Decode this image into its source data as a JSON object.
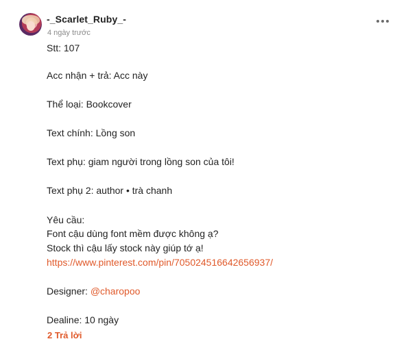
{
  "comment": {
    "author": "-_Scarlet_Ruby_-",
    "time": "4 ngày trước",
    "menu_icon": "more-dots-icon",
    "accent_color": "#e0592a",
    "lines": {
      "stt": "Stt: 107",
      "acc": "Acc nhận + trả: Acc này",
      "category": "Thể loại: Bookcover",
      "main_text": "Text chính: Lồng son",
      "sub_text": "Text phụ: giam người trong lồng son của tôi!",
      "sub_text2": "Text phụ 2: author • trà chanh",
      "request_label": "Yêu cầu:",
      "request_font": "Font cậu dùng font mềm được không ạ?",
      "request_stock": "Stock thì cậu lấy stock này giúp tớ ạ!",
      "stock_link": "https://www.pinterest.com/pin/705024516642656937/",
      "designer_label": "Designer: ",
      "designer_mention": "@charopoo",
      "deadline": "Dealine: 10 ngày"
    },
    "replies_label": "2 Trả lời"
  }
}
